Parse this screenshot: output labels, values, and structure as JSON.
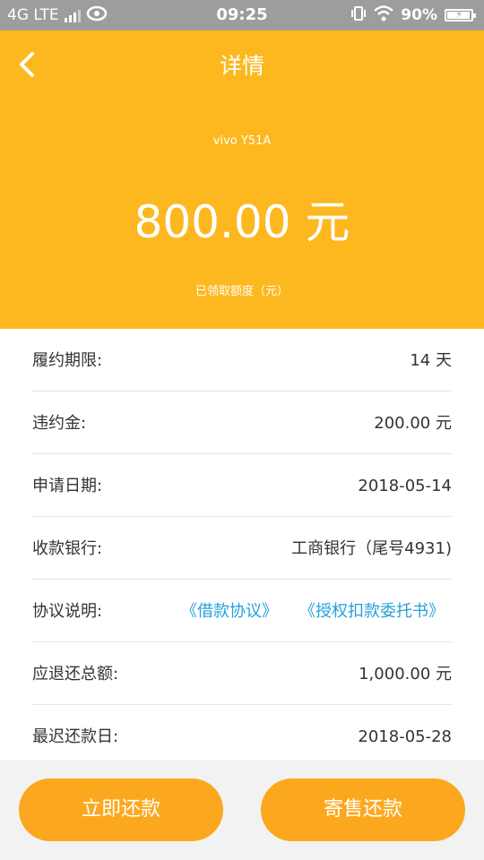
{
  "status_bar": {
    "network": "4G LTE",
    "time": "09:25",
    "battery": "90%"
  },
  "header": {
    "title": "详情",
    "device": "vivo Y51A",
    "amount": "800.00 元",
    "amount_label": "已领取额度（元）"
  },
  "details": [
    {
      "label": "履约期限:",
      "value": "14 天"
    },
    {
      "label": "违约金:",
      "value": "200.00 元"
    },
    {
      "label": "申请日期:",
      "value": "2018-05-14"
    },
    {
      "label": "收款银行:",
      "value": "工商银行（尾号4931)"
    },
    {
      "label": "协议说明:",
      "links": [
        "《借款协议》",
        "《授权扣款委托书》"
      ]
    },
    {
      "label": "应退还总额:",
      "value": "1,000.00 元"
    },
    {
      "label": "最迟还款日:",
      "value": "2018-05-28"
    }
  ],
  "actions": {
    "repay_now": "立即还款",
    "consign_repay": "寄售还款"
  },
  "colors": {
    "header_bg": "#fcb81e",
    "button_bg": "#fca81e",
    "link": "#25a0da"
  },
  "icons": [
    "back-arrow-icon",
    "signal-icon",
    "hd-voice-icon",
    "vibrate-icon",
    "wifi-icon",
    "battery-icon"
  ]
}
